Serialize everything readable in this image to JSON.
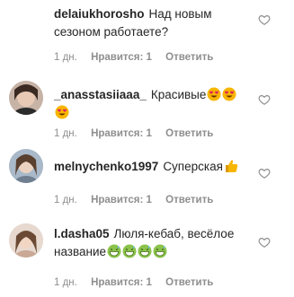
{
  "comments": [
    {
      "username": "delaiukhorosho",
      "text": "Над новым сезоном работаете?",
      "emojis": [],
      "age": "1 дн.",
      "likes": "Нравится: 1",
      "reply": "Ответить",
      "avatar": "none"
    },
    {
      "username": "_anasstasiiaaa_",
      "text": "Красивые",
      "emojis": [
        "heart-eyes-emoji",
        "heart-eyes-emoji",
        "heart-eyes-emoji"
      ],
      "age": "1 дн.",
      "likes": "Нравится: 1",
      "reply": "Ответить",
      "avatar": "photo"
    },
    {
      "username": "melnychenko1997",
      "text": "Суперская",
      "emojis": [
        "thumbs-up-emoji"
      ],
      "age": "1 дн.",
      "likes": "Нравится: 1",
      "reply": "Ответить",
      "avatar": "photo"
    },
    {
      "username": "l.dasha05",
      "text": "Люля-кебаб, весёлое название",
      "emojis": [
        "grinning-sweat-emoji",
        "grinning-sweat-emoji",
        "grinning-sweat-emoji",
        "grinning-sweat-emoji"
      ],
      "age": "1 дн.",
      "likes": "Нравится: 1",
      "reply": "Ответить",
      "avatar": "photo"
    }
  ],
  "colors": {
    "text": "#262626",
    "meta": "#8e8e8e",
    "heart_outline": "#8e8e8e"
  }
}
